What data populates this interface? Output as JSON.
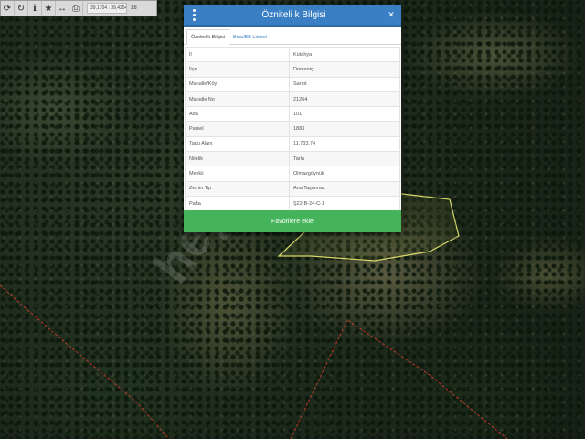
{
  "toolbar": {
    "buttons": [
      {
        "icon": "refresh-icon",
        "glyph": "⟳"
      },
      {
        "icon": "sync-icon",
        "glyph": "↻"
      },
      {
        "icon": "info-icon",
        "glyph": "ℹ"
      },
      {
        "icon": "star-icon",
        "glyph": "★"
      },
      {
        "icon": "move-icon",
        "glyph": "↔"
      },
      {
        "icon": "print-icon",
        "glyph": "⎙"
      }
    ],
    "coordinates": "39,1704 : 39,4254",
    "zoom": "18"
  },
  "dialog": {
    "title": "Özniteli k Bilgisi",
    "close_glyph": "✕",
    "tabs": [
      {
        "label": "Öznitelik Bilgisi",
        "active": true
      },
      {
        "label": "Bina/BB Listesi",
        "active": false
      }
    ],
    "rows": [
      {
        "key": "İl",
        "value": "Kütahya"
      },
      {
        "key": "İlçe",
        "value": "Domaniç"
      },
      {
        "key": "Mahalle/Köy",
        "value": "Sarıot"
      },
      {
        "key": "Mahalle No",
        "value": "21264"
      },
      {
        "key": "Ada",
        "value": "101"
      },
      {
        "key": "Parsel",
        "value": "1883"
      },
      {
        "key": "Tapu Alanı",
        "value": "11.733,74"
      },
      {
        "key": "Nitelik",
        "value": "Tarla"
      },
      {
        "key": "Mevkii",
        "value": "Olmazgöynük"
      },
      {
        "key": "Zemin Tip",
        "value": "Ana Taşınmaz"
      },
      {
        "key": "Pafta",
        "value": "Ş22-B-24-C-1"
      }
    ],
    "favorite_button": "Favorilere ekle"
  },
  "watermark": "hepsi",
  "colors": {
    "header": "#3a7fc4",
    "favorite_button": "#44b35a",
    "parcel_outline": "#d8d86a",
    "boundary_line": "#c0392b"
  }
}
